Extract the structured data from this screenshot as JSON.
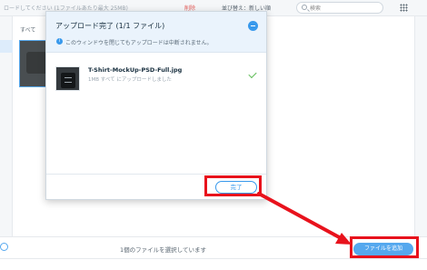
{
  "topbar": {
    "upload_hint": "ロードしてください (1ファイルあたり最大 25MB)",
    "delete_label": "削除",
    "sort_label": "並び替え：新しい順",
    "search_placeholder": "検索"
  },
  "files": {
    "all_label": "すべて"
  },
  "popup": {
    "title": "アップロード完了 (1/1 ファイル)",
    "note": "このウィンドウを閉じてもアップロードは中断されません。",
    "item": {
      "filename": "T-Shirt-MockUp-PSD-Full.jpg",
      "meta": "1MB すべて にアップロードしました"
    },
    "done_label": "完了"
  },
  "bottombar": {
    "status": "1個のファイルを選択しています",
    "add_label": "ファイルを追加"
  },
  "colors": {
    "accent": "#3899ec",
    "success": "#60bc57",
    "annotation": "#e8121c"
  }
}
